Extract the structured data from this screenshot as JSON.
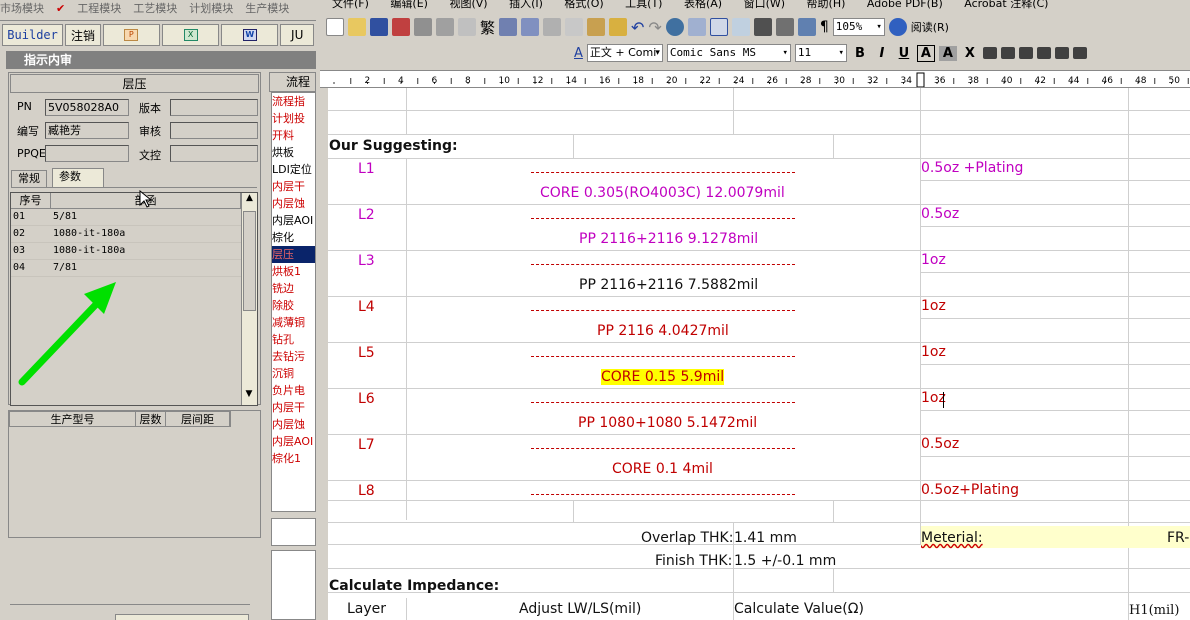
{
  "left_app": {
    "menu": [
      "市场模块",
      "工程模块",
      "工艺模块",
      "计划模块",
      "生产模块"
    ],
    "toolbar": {
      "builder": "Builder",
      "logout": "注销",
      "ju": "JU"
    },
    "window_title": "指示内审",
    "section_title": "层压",
    "fields": {
      "pn_label": "PN",
      "pn_value": "5V058028A0",
      "version_label": "版本",
      "version_value": "",
      "author_label": "编写",
      "author_value": "臧艳芳",
      "review_label": "审核",
      "review_value": "",
      "ppqe_label": "PPQE",
      "ppqe_value": "",
      "doc_label": "文控",
      "doc_value": ""
    },
    "tabs": [
      "常规",
      "参数"
    ],
    "grid": {
      "headers": [
        "序号",
        "部函"
      ],
      "rows": [
        {
          "seq": "01",
          "val": "5/81"
        },
        {
          "seq": "02",
          "val": "1080-it-180a"
        },
        {
          "seq": "03",
          "val": "1080-it-180a"
        },
        {
          "seq": "04",
          "val": "7/81"
        }
      ]
    },
    "grid2": {
      "headers": [
        "生产型号",
        "层数",
        "层间距"
      ]
    },
    "flow": {
      "header": "流程",
      "items": [
        "流程指",
        "计划投",
        "开料",
        "烘板",
        "LDI定位",
        "内层干",
        "内层蚀",
        "内层AOI",
        "棕化",
        "层压",
        "烘板1",
        "铣边",
        "除胶",
        "减薄铜",
        "钻孔",
        "去钻污",
        "沉铜",
        "负片电",
        "内层干",
        "内层蚀",
        "内层AOI",
        "棕化1"
      ],
      "selected_index": 9
    }
  },
  "word": {
    "menu": [
      "文件(F)",
      "编辑(E)",
      "视图(V)",
      "插入(I)",
      "格式(O)",
      "工具(T)",
      "表格(A)",
      "窗口(W)",
      "帮助(H)",
      "Adobe PDF(B)",
      "Acrobat 注释(C)"
    ],
    "toolbar": {
      "zoom": "105%",
      "read": "阅读(R)",
      "trad": "繁"
    },
    "format": {
      "style": "正文 + Comi",
      "font": "Comic Sans MS",
      "size": "11"
    },
    "ruler_marks": [
      "2",
      "4",
      "6",
      "8",
      "10",
      "12",
      "14",
      "16",
      "18",
      "20",
      "22",
      "24",
      "26",
      "28",
      "30",
      "32",
      "34",
      "36",
      "38",
      "40",
      "42",
      "44",
      "46",
      "48",
      "50"
    ],
    "doc": {
      "suggest_heading": "Our Suggesting:",
      "layers": [
        {
          "label": "L1",
          "spec": "0.5oz +Plating"
        },
        {
          "label": "L2",
          "spec": "0.5oz"
        },
        {
          "label": "L3",
          "spec": "1oz"
        },
        {
          "label": "L4",
          "spec": "1oz"
        },
        {
          "label": "L5",
          "spec": "1oz"
        },
        {
          "label": "L6",
          "spec": "1oz"
        },
        {
          "label": "L7",
          "spec": "0.5oz"
        },
        {
          "label": "L8",
          "spec": "0.5oz+Plating"
        }
      ],
      "dielectrics": [
        "CORE  0.305(RO4003C)  12.0079mil",
        "PP  2116+2116  9.1278mil",
        "PP  2116+2116  7.5882mil",
        "PP  2116  4.0427mil",
        "CORE  0.15  5.9mil",
        "PP  1080+1080  5.1472mil",
        "CORE  0.1  4mil"
      ],
      "overlap_label": "Overlap THK:",
      "overlap_value": "1.41 mm",
      "finish_label": "Finish THK:",
      "finish_value": "1.5 +/-0.1 mm",
      "meterial_label": "Meterial:",
      "meterial_value": "FR-",
      "impedance_heading": "Calculate Impedance:",
      "imp_headers": [
        "Layer",
        "Adjust LW/LS(mil)",
        "Calculate Value(Ω)",
        "H1(mil)"
      ]
    }
  }
}
